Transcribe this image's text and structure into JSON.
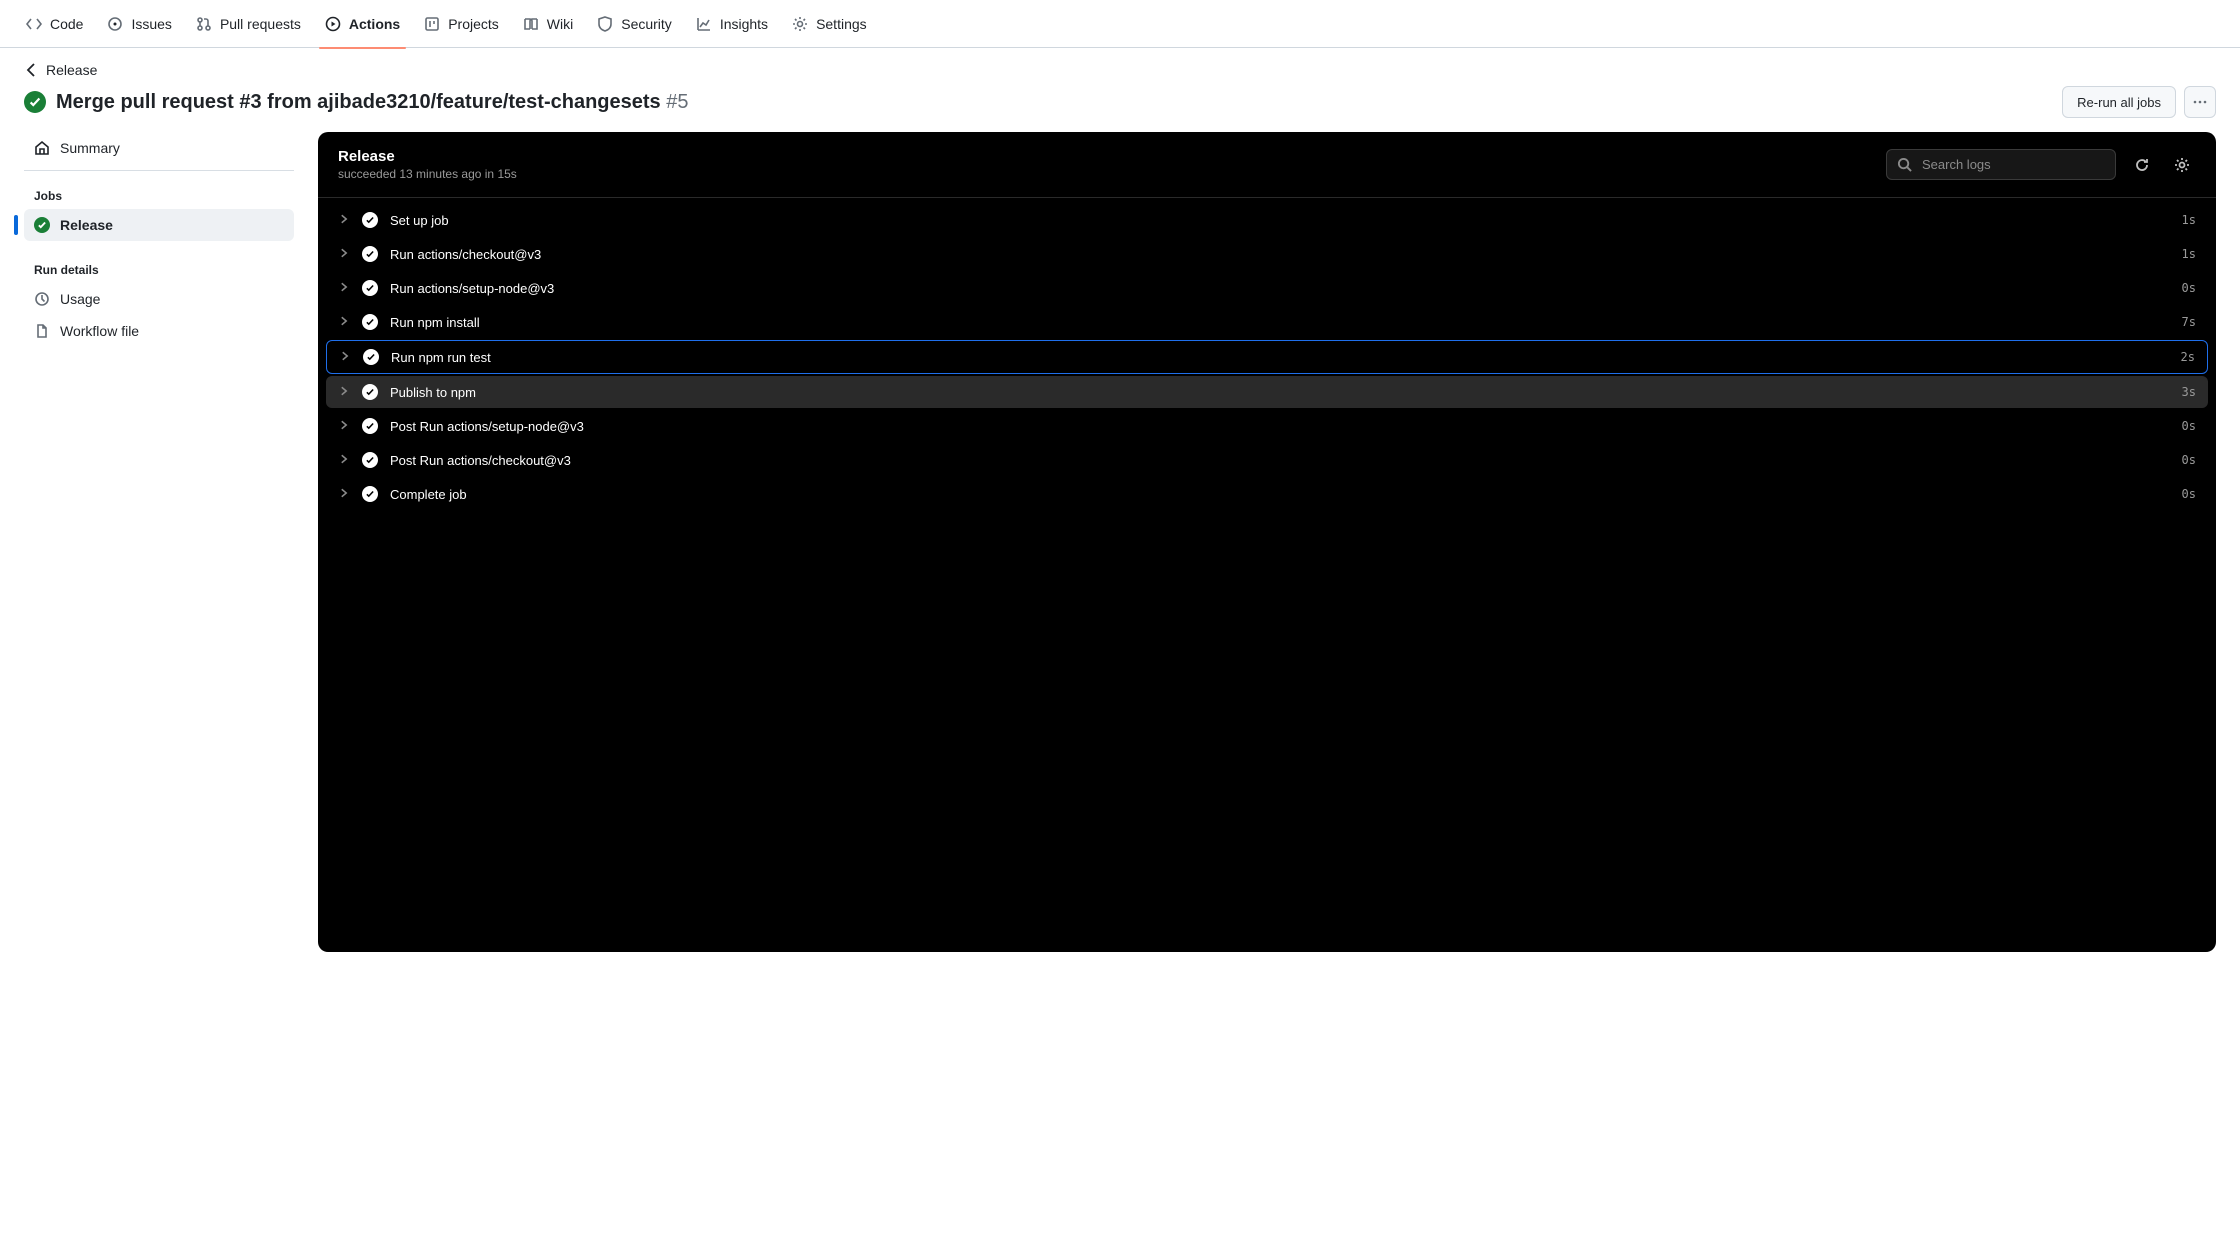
{
  "tabs": [
    {
      "label": "Code",
      "icon": "code"
    },
    {
      "label": "Issues",
      "icon": "issue"
    },
    {
      "label": "Pull requests",
      "icon": "pr"
    },
    {
      "label": "Actions",
      "icon": "play",
      "active": true
    },
    {
      "label": "Projects",
      "icon": "project"
    },
    {
      "label": "Wiki",
      "icon": "book"
    },
    {
      "label": "Security",
      "icon": "shield"
    },
    {
      "label": "Insights",
      "icon": "graph"
    },
    {
      "label": "Settings",
      "icon": "gear"
    }
  ],
  "breadcrumb": {
    "back": "Release"
  },
  "title": {
    "text": "Merge pull request #3 from ajibade3210/feature/test-changesets",
    "number": "#5"
  },
  "actions": {
    "rerun": "Re-run all jobs"
  },
  "sidebar": {
    "summary": "Summary",
    "jobs_header": "Jobs",
    "job_release": "Release",
    "details_header": "Run details",
    "usage": "Usage",
    "workflow_file": "Workflow file"
  },
  "panel": {
    "title": "Release",
    "subtitle": "succeeded 13 minutes ago in 15s",
    "search_placeholder": "Search logs"
  },
  "steps": [
    {
      "name": "Set up job",
      "time": "1s",
      "state": ""
    },
    {
      "name": "Run actions/checkout@v3",
      "time": "1s",
      "state": ""
    },
    {
      "name": "Run actions/setup-node@v3",
      "time": "0s",
      "state": ""
    },
    {
      "name": "Run npm install",
      "time": "7s",
      "state": ""
    },
    {
      "name": "Run npm run test",
      "time": "2s",
      "state": "selected"
    },
    {
      "name": "Publish to npm",
      "time": "3s",
      "state": "hover"
    },
    {
      "name": "Post Run actions/setup-node@v3",
      "time": "0s",
      "state": ""
    },
    {
      "name": "Post Run actions/checkout@v3",
      "time": "0s",
      "state": ""
    },
    {
      "name": "Complete job",
      "time": "0s",
      "state": ""
    }
  ]
}
